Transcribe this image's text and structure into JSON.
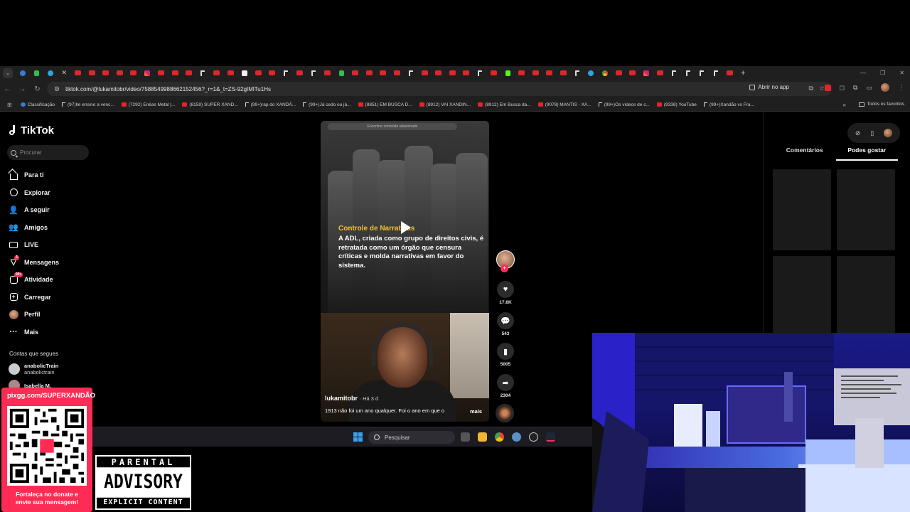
{
  "browser": {
    "url": "tiktok.com/@lukamitobr/video/7588549988662152456?_r=1&_t=ZS-92gIMlTu1Hs",
    "open_app_label": "Abrir no app",
    "bookmarks": [
      {
        "label": "Classificação",
        "icon": "blue"
      },
      {
        "label": "(97)Ile ensino a venc...",
        "icon": "tiktok"
      },
      {
        "label": "(7292) Enéas Metal |...",
        "icon": "youtube"
      },
      {
        "label": "(8159) SUPER XAND...",
        "icon": "youtube"
      },
      {
        "label": "(99+)rap do XANDÃ...",
        "icon": "tiktok"
      },
      {
        "label": "(99+)Já cedo ou já...",
        "icon": "tiktok"
      },
      {
        "label": "(8851) EM BUSCA D...",
        "icon": "youtube"
      },
      {
        "label": "(8912) VAI XANDIN...",
        "icon": "youtube"
      },
      {
        "label": "(8912) Em Busca da...",
        "icon": "youtube"
      },
      {
        "label": "(9078) MANTIS - XA...",
        "icon": "youtube"
      },
      {
        "label": "(99+)Os vídeos de c...",
        "icon": "tiktok"
      },
      {
        "label": "(9338) YouTube",
        "icon": "youtube"
      },
      {
        "label": "(99+)Xandão vs Fra...",
        "icon": "tiktok"
      }
    ],
    "all_bookmarks_label": "Todos os favoritos"
  },
  "tiktok": {
    "logo_text": "TikTok",
    "search_placeholder": "Procurar",
    "nav": [
      {
        "label": "Para ti",
        "icon": "home-icon"
      },
      {
        "label": "Explorar",
        "icon": "compass-icon"
      },
      {
        "label": "A seguir",
        "icon": "following-icon"
      },
      {
        "label": "Amigos",
        "icon": "friends-icon"
      },
      {
        "label": "LIVE",
        "icon": "live-icon"
      },
      {
        "label": "Mensagens",
        "icon": "messages-icon",
        "badge": "3"
      },
      {
        "label": "Atividade",
        "icon": "activity-icon",
        "badge": "99+"
      },
      {
        "label": "Carregar",
        "icon": "upload-icon"
      },
      {
        "label": "Perfil",
        "icon": "profile-icon"
      },
      {
        "label": "Mais",
        "icon": "more-icon"
      }
    ],
    "following_title": "Contas que segues",
    "following": [
      {
        "name": "anabolicTrain",
        "handle": "anabolictrain"
      },
      {
        "name": "Isabella M.",
        "handle": ""
      }
    ],
    "video": {
      "inner_search": "Encontrar conteúdo relacionado",
      "overlay_title": "Controle de Narrativas",
      "overlay_text": "A ADL, criada como grupo de direitos civis, é retratada como um órgão que censura críticas e molda narrativas em favor do sistema.",
      "username": "lukamitobr",
      "date": "· Há 3 d",
      "caption": "1913 não foi um ano qualquer. Foi o ano em que o",
      "more_label": "mais"
    },
    "actions": {
      "likes": "17.6K",
      "comments": "543",
      "saves": "5005",
      "shares": "2304"
    },
    "right_tabs": [
      "Comentários",
      "Podes gostar"
    ]
  },
  "taskbar": {
    "search_placeholder": "Pesquisar"
  },
  "overlay": {
    "qr_url": "pixgg.com/SUPERXANDÃO",
    "qr_caption_1": "Fortaleça no donate e",
    "qr_caption_2": "envie sua mensagem!",
    "pa_top": "PARENTAL",
    "pa_mid": "ADVISORY",
    "pa_bot": "EXPLICIT CONTENT"
  },
  "colors": {
    "tiktok_red": "#fe2c55",
    "overlay_yellow": "#f6c12c",
    "youtube_red": "#e3242b",
    "windows_blue": "#3aa0f0"
  }
}
